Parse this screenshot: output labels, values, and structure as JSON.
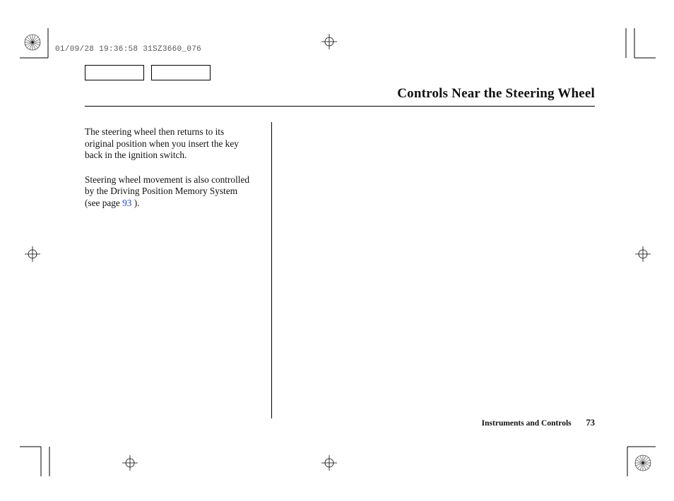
{
  "header_code": "01/09/28 19:36:58 31SZ3660_076",
  "title": "Controls Near the Steering Wheel",
  "body": {
    "para1": "The steering wheel then returns to its original position when you insert the key back in the ignition switch.",
    "para2_a": "Steering wheel movement is also controlled by the Driving Position Memory System (see page ",
    "page_ref": "93",
    "para2_b": " )."
  },
  "footer": {
    "section": "Instruments and Controls",
    "page_number": "73"
  }
}
